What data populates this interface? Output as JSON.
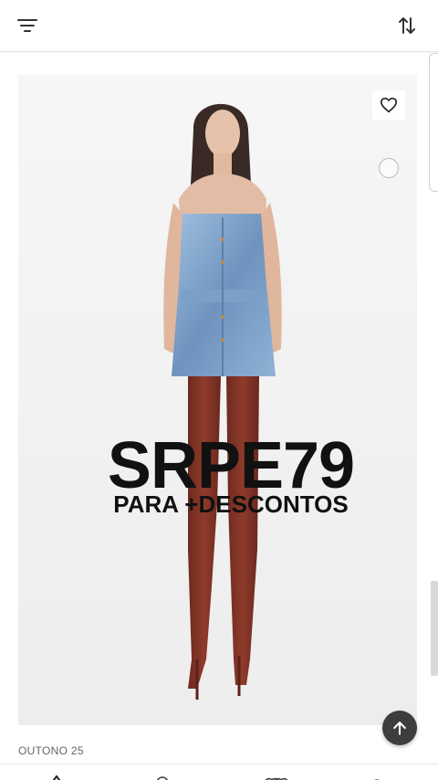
{
  "header": {
    "filter_icon": "filter-lines-icon",
    "sort_icon": "sort-arrows-icon"
  },
  "product": {
    "favorite_icon": "heart-outline-icon",
    "promo_code": "SRPE79",
    "promo_text": "PARA +DESCONTOS",
    "collection_label": "OUTONO 25"
  },
  "back_to_top_icon": "arrow-up-icon",
  "bottom_nav": {
    "icons": [
      "home-icon",
      "search-icon",
      "favorites-icon",
      "account-icon"
    ]
  },
  "colors": {
    "promo_text": "#111111",
    "back_to_top_bg": "#3d3d3d",
    "image_background": "#f2f2f2"
  }
}
